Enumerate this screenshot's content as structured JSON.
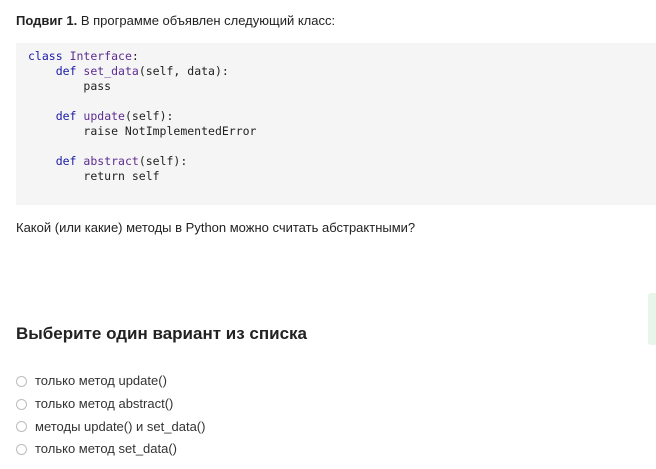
{
  "task": {
    "label": "Подвиг 1.",
    "text": " В программе объявлен следующий класс:",
    "question": "Какой (или какие) методы в Python можно считать абстрактными?"
  },
  "code": {
    "line1_kw": "class",
    "line1_name": "Interface",
    "line1_rest": ":",
    "line2_kw": "def",
    "line2_name": "set_data",
    "line2_rest": "(self, data):",
    "line3": "pass",
    "line5_kw": "def",
    "line5_name": "update",
    "line5_rest": "(self):",
    "line6": "raise NotImplementedError",
    "line8_kw": "def",
    "line8_name": "abstract",
    "line8_rest": "(self):",
    "line9": "return self"
  },
  "answer": {
    "title": "Выберите один вариант из списка",
    "options": [
      {
        "label": "только метод update()"
      },
      {
        "label": "только метод abstract()"
      },
      {
        "label": "методы update() и set_data()"
      },
      {
        "label": "только метод set_data()"
      }
    ]
  },
  "colors": {
    "keyword": "#1a1aa6",
    "name": "#5c2d91",
    "code_bg": "#f5f5f5",
    "side_tab": "#e8f5ea"
  }
}
